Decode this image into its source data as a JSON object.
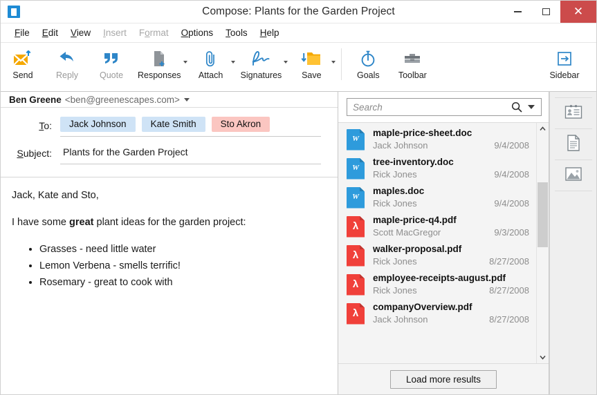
{
  "window": {
    "title": "Compose: Plants for the Garden Project",
    "app_icon": "mail-app-icon",
    "controls": {
      "minimize": "minimize-icon",
      "maximize": "maximize-icon",
      "close": "✕"
    }
  },
  "menubar": [
    {
      "label": "File",
      "accel": "F",
      "disabled": false
    },
    {
      "label": "Edit",
      "accel": "E",
      "disabled": false
    },
    {
      "label": "View",
      "accel": "V",
      "disabled": false
    },
    {
      "label": "Insert",
      "accel": "I",
      "disabled": true
    },
    {
      "label": "Format",
      "accel": "o",
      "disabled": true
    },
    {
      "label": "Options",
      "accel": "O",
      "disabled": false
    },
    {
      "label": "Tools",
      "accel": "T",
      "disabled": false
    },
    {
      "label": "Help",
      "accel": "H",
      "disabled": false
    }
  ],
  "toolbar": {
    "items": [
      {
        "label": "Send",
        "icon": "envelope-send-icon",
        "caret": false,
        "dim": false
      },
      {
        "label": "Reply",
        "icon": "reply-arrow-icon",
        "caret": false,
        "dim": true
      },
      {
        "label": "Quote",
        "icon": "quote-marks-icon",
        "caret": false,
        "dim": true
      },
      {
        "label": "Responses",
        "icon": "document-plus-icon",
        "caret": true,
        "dim": false
      },
      {
        "label": "Attach",
        "icon": "paperclip-icon",
        "caret": true,
        "dim": false
      },
      {
        "label": "Signatures",
        "icon": "signature-icon",
        "caret": true,
        "dim": false
      },
      {
        "label": "Save",
        "icon": "folder-save-icon",
        "caret": true,
        "dim": false
      },
      {
        "label": "Goals",
        "icon": "stopwatch-icon",
        "caret": false,
        "dim": false
      },
      {
        "label": "Toolbar",
        "icon": "toolbox-icon",
        "caret": false,
        "dim": false
      }
    ],
    "sidebar_button": {
      "label": "Sidebar",
      "icon": "sidebar-panel-icon"
    }
  },
  "compose": {
    "from": {
      "name": "Ben Greene",
      "address": "<ben@greenescapes.com>",
      "dropdown_icon": "chevron-down-icon"
    },
    "to": {
      "label": "To:",
      "accel": "T",
      "recipients": [
        {
          "name": "Jack Johnson",
          "color": "#cfe3f6",
          "kind": "blue"
        },
        {
          "name": "Kate Smith",
          "color": "#cfe3f6",
          "kind": "blue"
        },
        {
          "name": "Sto Akron",
          "color": "#fbc6c1",
          "kind": "pink"
        }
      ]
    },
    "subject": {
      "label": "Subject:",
      "accel": "S",
      "value": "Plants for the Garden Project"
    },
    "body": {
      "greeting": "Jack, Kate and Sto,",
      "intro_before": "I have some ",
      "intro_bold": "great",
      "intro_after": " plant ideas for the garden project:",
      "bullets": [
        "Grasses - need little water",
        "Lemon Verbena - smells terrific!",
        "Rosemary - great to cook with"
      ]
    }
  },
  "results_panel": {
    "search": {
      "placeholder": "Search",
      "value": "",
      "search_icon": "search-icon",
      "dropdown_icon": "chevron-down-icon"
    },
    "files": [
      {
        "name": "maple-price-sheet.doc",
        "author": "Jack Johnson",
        "date": "9/4/2008",
        "type": "doc",
        "mark": "W"
      },
      {
        "name": "tree-inventory.doc",
        "author": "Rick Jones",
        "date": "9/4/2008",
        "type": "doc",
        "mark": "W"
      },
      {
        "name": "maples.doc",
        "author": "Rick Jones",
        "date": "9/4/2008",
        "type": "doc",
        "mark": "W"
      },
      {
        "name": "maple-price-q4.pdf",
        "author": "Scott MacGregor",
        "date": "9/3/2008",
        "type": "pdf",
        "mark": "λ"
      },
      {
        "name": "walker-proposal.pdf",
        "author": "Rick Jones",
        "date": "8/27/2008",
        "type": "pdf",
        "mark": "λ"
      },
      {
        "name": "employee-receipts-august.pdf",
        "author": "Rick Jones",
        "date": "8/27/2008",
        "type": "pdf",
        "mark": "λ"
      },
      {
        "name": "companyOverview.pdf",
        "author": "Jack Johnson",
        "date": "8/27/2008",
        "type": "pdf",
        "mark": "λ"
      }
    ],
    "scrollbar": {
      "up_icon": "chevron-up-icon",
      "down_icon": "chevron-down-icon"
    },
    "load_more_label": "Load more results"
  },
  "tabstrip": {
    "tabs": [
      {
        "icon": "contact-card-icon"
      },
      {
        "icon": "document-text-icon"
      },
      {
        "icon": "image-photo-icon"
      }
    ]
  },
  "colors": {
    "accent_blue": "#1e8bd4",
    "close_red": "#cc4b4b",
    "doc_blue": "#2e9bdc",
    "pdf_red": "#f0403a",
    "pill_blue": "#cfe3f6",
    "pill_pink": "#fbc6c1"
  }
}
